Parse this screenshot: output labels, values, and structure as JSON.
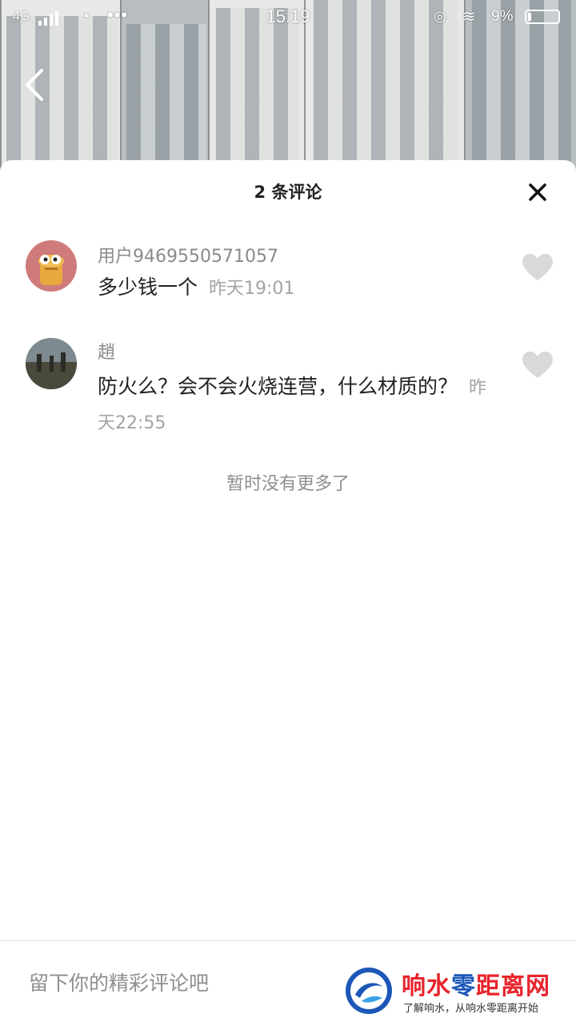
{
  "status_bar": {
    "network": "4G",
    "time": "15:19",
    "battery": "9%"
  },
  "panel": {
    "title": "2 条评论"
  },
  "comments": [
    {
      "username": "用户9469550571057",
      "text": "多少钱一个",
      "time": "昨天19:01"
    },
    {
      "username": "趙",
      "text": "防火么？会不会火烧连营，什么材质的？",
      "time": "昨天22:55"
    }
  ],
  "no_more_text": "暂时没有更多了",
  "input": {
    "placeholder": "留下你的精彩评论吧"
  },
  "watermark": {
    "title_red_1": "响水",
    "title_blue": "零",
    "title_red_2": "距离网",
    "subtitle": "了解响水，从响水零距离开始"
  },
  "colors": {
    "watermark_red": "#e8242c",
    "watermark_blue": "#1c57b8",
    "heart": "#d9d9d9"
  }
}
